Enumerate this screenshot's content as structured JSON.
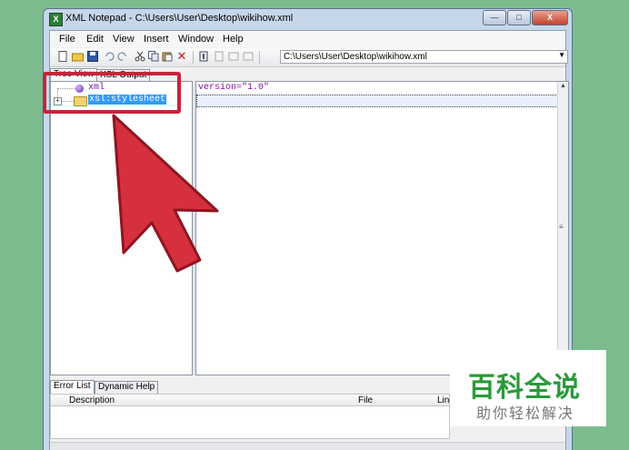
{
  "window": {
    "title": "XML Notepad - C:\\Users\\User\\Desktop\\wikihow.xml",
    "app_icon_letter": "X",
    "minimize_glyph": "—",
    "maximize_glyph": "□",
    "close_glyph": "X"
  },
  "menu": [
    "File",
    "Edit",
    "View",
    "Insert",
    "Window",
    "Help"
  ],
  "toolbar": {
    "path_value": "C:\\Users\\User\\Desktop\\wikihow.xml",
    "icons": [
      "new-file-icon",
      "open-folder-icon",
      "save-icon",
      "undo-icon",
      "redo-icon",
      "cut-icon",
      "copy-icon",
      "paste-icon",
      "delete-icon",
      "nudge-up-icon",
      "nudge-down-icon",
      "nudge-left-icon",
      "nudge-right-icon"
    ],
    "delete_glyph": "✕",
    "combo_arrow": "▼"
  },
  "tabs": {
    "tree_view": "Tree View",
    "xsl_output": "XSL Output"
  },
  "tree": {
    "nodes": [
      {
        "label": "xml",
        "kind": "processing-instruction"
      },
      {
        "label": "xsl:stylesheet",
        "kind": "element",
        "selected": true,
        "expander": "+"
      }
    ]
  },
  "value_pane": {
    "row1": "version=\"1.0\""
  },
  "bottom_tabs": {
    "error_list": "Error List",
    "dynamic_help": "Dynamic Help"
  },
  "error_list": {
    "columns": [
      "Description",
      "File",
      "Line"
    ]
  },
  "watermark": {
    "brand": "百科全说",
    "tagline": "助你轻松解决"
  },
  "colors": {
    "highlight_red": "#c4253a",
    "selection_blue": "#3399ff",
    "attr_purple": "#8a0ea0",
    "brand_green": "#2a9a3a"
  }
}
